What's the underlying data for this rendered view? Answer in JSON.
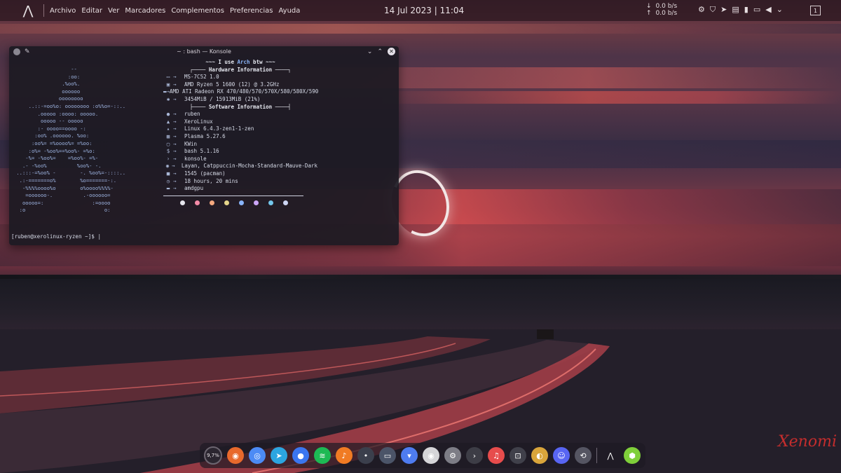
{
  "topbar": {
    "logo_icon": "xerolinux-logo-icon",
    "menu": [
      "Archivo",
      "Editar",
      "Ver",
      "Marcadores",
      "Complementos",
      "Preferencias",
      "Ayuda"
    ],
    "clock": "14 Jul 2023 | 11:04",
    "net_down": "0.0 b/s",
    "net_up": "0.0 b/s",
    "desktop_number": "1"
  },
  "konsole": {
    "title": "~ : bash — Konsole",
    "header_tag_pre": "~~~ I use ",
    "header_tag_arch": "Arch",
    "header_tag_post": " btw ~~~",
    "hardware_title": "Hardware Information",
    "software_title": "Software Information",
    "hardware": [
      {
        "icon": "motherboard-icon",
        "glyph": "▭",
        "value": "MS-7C52 1.0"
      },
      {
        "icon": "cpu-icon",
        "glyph": "▣",
        "value": "AMD Ryzen 5 1600 (12) @ 3.2GHz"
      },
      {
        "icon": "gpu-icon",
        "glyph": "▬",
        "value": "AMD ATI Radeon RX 470/480/570/570X/580/580X/590"
      },
      {
        "icon": "memory-icon",
        "glyph": "✱",
        "value": "3454MiB / 15913MiB (21%)"
      }
    ],
    "software": [
      {
        "icon": "user-icon",
        "glyph": "●",
        "value": "ruben"
      },
      {
        "icon": "arch-icon",
        "glyph": "▲",
        "value": "XeroLinux"
      },
      {
        "icon": "kernel-icon",
        "glyph": "▴",
        "value": "Linux 6.4.3-zen1-1-zen"
      },
      {
        "icon": "de-icon",
        "glyph": "▦",
        "value": "Plasma 5.27.6"
      },
      {
        "icon": "wm-icon",
        "glyph": "▢",
        "value": "KWin"
      },
      {
        "icon": "shell-icon",
        "glyph": "$",
        "value": "bash 5.1.16"
      },
      {
        "icon": "terminal-icon",
        "glyph": "›",
        "value": "konsole"
      },
      {
        "icon": "theme-icon",
        "glyph": "◉",
        "value": "Layan, Catppuccin-Mocha-Standard-Mauve-Dark"
      },
      {
        "icon": "package-icon",
        "glyph": "■",
        "value": "1545 (pacman)"
      },
      {
        "icon": "uptime-icon",
        "glyph": "◷",
        "value": "18 hours, 20 mins"
      },
      {
        "icon": "driver-icon",
        "glyph": "▬",
        "value": "amdgpu"
      }
    ],
    "palette": [
      "#e6e6ee",
      "#f38ba8",
      "#f5a97f",
      "#e5d48a",
      "#89b4fa",
      "#cba6f7",
      "#74c7ec",
      "#cdd6f4"
    ],
    "prompt": "[ruben@xerolinux-ryzen ~]$ |"
  },
  "dock": {
    "cpu_usage": "9,7%",
    "apps": [
      {
        "name": "firefox-icon",
        "color": "#e8692c",
        "glyph": "◉"
      },
      {
        "name": "chromium-icon",
        "color": "#4c8bf5",
        "glyph": "◎"
      },
      {
        "name": "telegram-icon",
        "color": "#2ca5e0",
        "glyph": "➤"
      },
      {
        "name": "signal-icon",
        "color": "#3a76f0",
        "glyph": "●"
      },
      {
        "name": "spotify-icon",
        "color": "#1db954",
        "glyph": "≋"
      },
      {
        "name": "audio-icon",
        "color": "#f07b23",
        "glyph": "♪"
      },
      {
        "name": "media-icon",
        "color": "#3b3f4c",
        "glyph": "•"
      },
      {
        "name": "files-icon",
        "color": "#4b5468",
        "glyph": "▭"
      },
      {
        "name": "store-icon",
        "color": "#4e7cf0",
        "glyph": "▾"
      },
      {
        "name": "disk-icon",
        "color": "#d5d5d8",
        "glyph": "◉"
      },
      {
        "name": "settings-icon",
        "color": "#7d7d86",
        "glyph": "⚙"
      },
      {
        "name": "konsole-icon",
        "color": "#3d3d46",
        "glyph": "›"
      },
      {
        "name": "music-icon",
        "color": "#e74c4c",
        "glyph": "♫"
      },
      {
        "name": "screenshot-icon",
        "color": "#40404a",
        "glyph": "⊡"
      },
      {
        "name": "paint-icon",
        "color": "#d9a53b",
        "glyph": "◐"
      },
      {
        "name": "discord-icon",
        "color": "#5865f2",
        "glyph": "☺"
      },
      {
        "name": "steam-icon",
        "color": "#555562",
        "glyph": "⟲"
      }
    ],
    "tail": [
      {
        "name": "xero-launcher-icon",
        "color": "transparent",
        "glyph": "⋀"
      },
      {
        "name": "package-box-icon",
        "color": "#7fcf3a",
        "glyph": "⬢"
      }
    ]
  },
  "signature": "Xenomi"
}
